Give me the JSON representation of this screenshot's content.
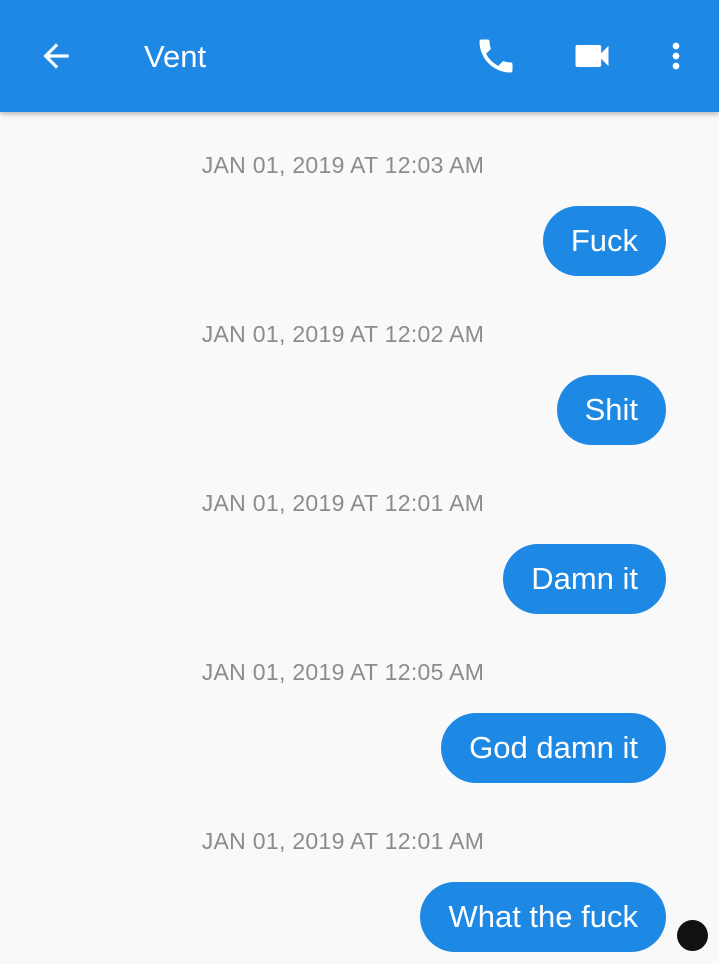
{
  "header": {
    "title": "Vent",
    "icons": {
      "back": "arrow-back-icon",
      "call": "phone-icon",
      "video": "video-camera-icon",
      "more": "more-vert-icon"
    }
  },
  "colors": {
    "accent": "#1e88e5",
    "background": "#f9f9f9",
    "timestamp": "#8c8c8c"
  },
  "messages": [
    {
      "timestamp": "JAN 01, 2019 AT 12:03 AM",
      "text": "Fuck"
    },
    {
      "timestamp": "JAN 01, 2019 AT 12:02 AM",
      "text": "Shit"
    },
    {
      "timestamp": "JAN 01, 2019 AT 12:01 AM",
      "text": "Damn it"
    },
    {
      "timestamp": "JAN 01, 2019 AT 12:05 AM",
      "text": "God damn it"
    },
    {
      "timestamp": "JAN 01, 2019 AT 12:01 AM",
      "text": "What the fuck"
    }
  ]
}
